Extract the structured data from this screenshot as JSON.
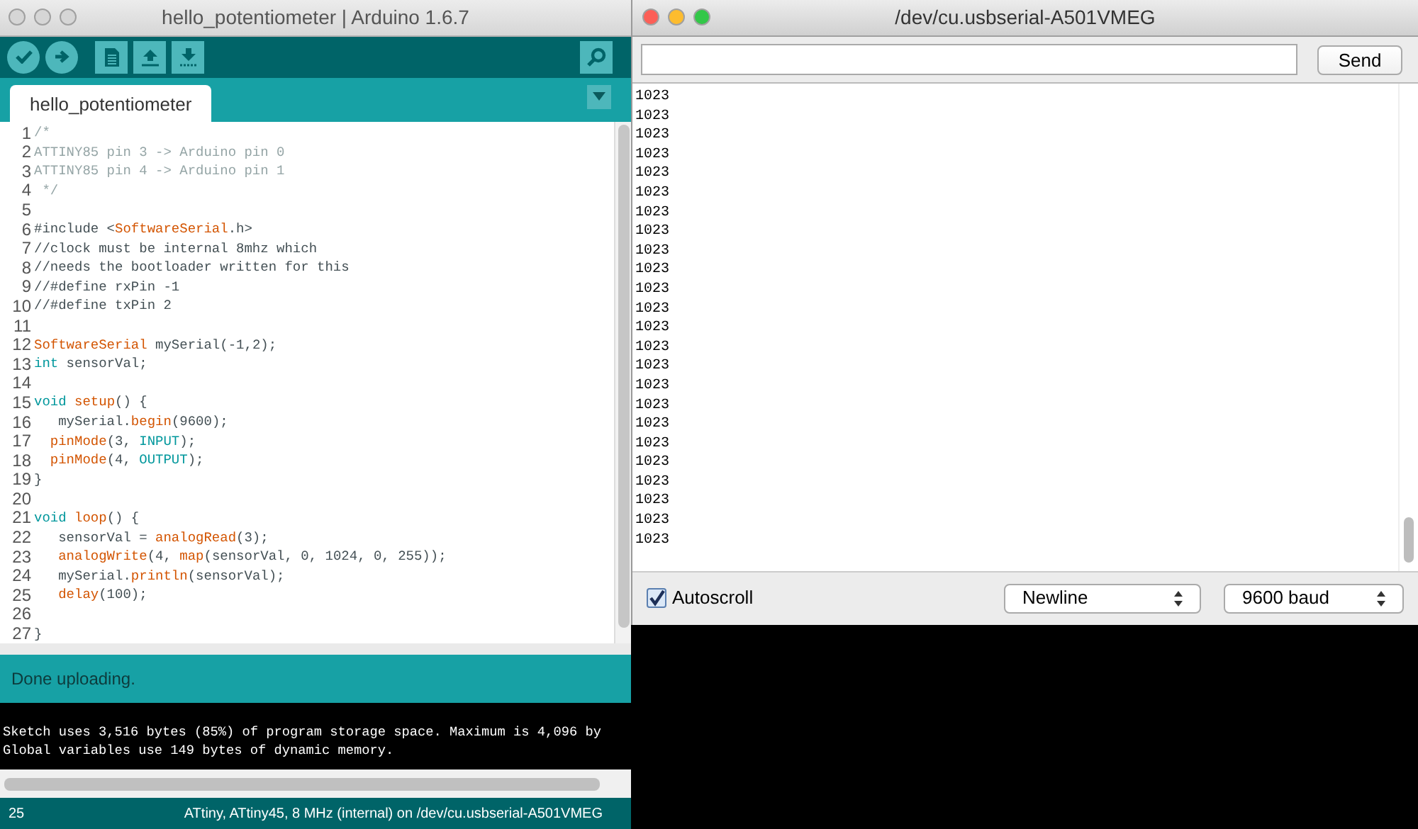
{
  "ide_window": {
    "title": "hello_potentiometer | Arduino 1.6.7",
    "tabs": [
      {
        "label": "hello_potentiometer",
        "selected": true
      }
    ],
    "code_lines": [
      {
        "number": "1",
        "segments": [
          {
            "kind": "comment",
            "text": "/*"
          }
        ]
      },
      {
        "number": "2",
        "segments": [
          {
            "kind": "comment",
            "text": "ATTINY85 pin 3 -> Arduino pin 0"
          }
        ]
      },
      {
        "number": "3",
        "segments": [
          {
            "kind": "comment",
            "text": "ATTINY85 pin 4 -> Arduino pin 1"
          }
        ]
      },
      {
        "number": "4",
        "segments": [
          {
            "kind": "comment",
            "text": " */"
          }
        ]
      },
      {
        "number": "5"
      },
      {
        "number": "6",
        "segments": [
          {
            "kind": "plain",
            "text": "#include <"
          },
          {
            "kind": "function",
            "text": "SoftwareSerial"
          },
          {
            "kind": "plain",
            "text": ".h>"
          }
        ]
      },
      {
        "number": "7",
        "segments": [
          {
            "kind": "plain",
            "text": "//clock must be internal 8mhz which"
          }
        ]
      },
      {
        "number": "8",
        "segments": [
          {
            "kind": "plain",
            "text": "//needs the bootloader written for this"
          }
        ]
      },
      {
        "number": "9",
        "segments": [
          {
            "kind": "plain",
            "text": "//#define rxPin -1"
          }
        ]
      },
      {
        "number": "10",
        "segments": [
          {
            "kind": "plain",
            "text": "//#define txPin 2"
          }
        ]
      },
      {
        "number": "11"
      },
      {
        "number": "12",
        "segments": [
          {
            "kind": "function",
            "text": "SoftwareSerial"
          },
          {
            "kind": "plain",
            "text": " mySerial(-1,2);"
          }
        ]
      },
      {
        "number": "13",
        "segments": [
          {
            "kind": "keyword",
            "text": "int"
          },
          {
            "kind": "plain",
            "text": " sensorVal;"
          }
        ]
      },
      {
        "number": "14"
      },
      {
        "number": "15",
        "segments": [
          {
            "kind": "keyword",
            "text": "void"
          },
          {
            "kind": "function",
            "text": " setup"
          },
          {
            "kind": "plain",
            "text": "() {"
          }
        ]
      },
      {
        "number": "16",
        "segments": [
          {
            "kind": "plain",
            "text": "   mySerial."
          },
          {
            "kind": "function",
            "text": "begin"
          },
          {
            "kind": "plain",
            "text": "(9600);"
          }
        ]
      },
      {
        "number": "17",
        "segments": [
          {
            "kind": "function",
            "text": "  pinMode"
          },
          {
            "kind": "plain",
            "text": "(3, "
          },
          {
            "kind": "keyword",
            "text": "INPUT"
          },
          {
            "kind": "plain",
            "text": ");"
          }
        ]
      },
      {
        "number": "18",
        "segments": [
          {
            "kind": "function",
            "text": "  pinMode"
          },
          {
            "kind": "plain",
            "text": "(4, "
          },
          {
            "kind": "keyword",
            "text": "OUTPUT"
          },
          {
            "kind": "plain",
            "text": ");"
          }
        ]
      },
      {
        "number": "19",
        "segments": [
          {
            "kind": "plain",
            "text": "}"
          }
        ]
      },
      {
        "number": "20"
      },
      {
        "number": "21",
        "segments": [
          {
            "kind": "keyword",
            "text": "void"
          },
          {
            "kind": "function",
            "text": " loop"
          },
          {
            "kind": "plain",
            "text": "() {"
          }
        ]
      },
      {
        "number": "22",
        "segments": [
          {
            "kind": "plain",
            "text": "   sensorVal = "
          },
          {
            "kind": "function",
            "text": "analogRead"
          },
          {
            "kind": "plain",
            "text": "(3);"
          }
        ]
      },
      {
        "number": "23",
        "segments": [
          {
            "kind": "function",
            "text": "   analogWrite"
          },
          {
            "kind": "plain",
            "text": "(4, "
          },
          {
            "kind": "function",
            "text": "map"
          },
          {
            "kind": "plain",
            "text": "(sensorVal, 0, 1024, 0, 255));"
          }
        ]
      },
      {
        "number": "24",
        "segments": [
          {
            "kind": "plain",
            "text": "   mySerial."
          },
          {
            "kind": "function",
            "text": "println"
          },
          {
            "kind": "plain",
            "text": "(sensorVal);"
          }
        ]
      },
      {
        "number": "25",
        "segments": [
          {
            "kind": "function",
            "text": "   delay"
          },
          {
            "kind": "plain",
            "text": "(100);"
          }
        ]
      },
      {
        "number": "26"
      },
      {
        "number": "27",
        "segments": [
          {
            "kind": "plain",
            "text": "}"
          }
        ]
      }
    ],
    "status_message": "Done uploading.",
    "console_lines": [
      "Sketch uses 3,516 bytes (85%) of program storage space. Maximum is 4,096 by",
      "Global variables use 149 bytes of dynamic memory."
    ],
    "status_bar": {
      "line": "25",
      "board": "ATtiny, ATtiny45, 8 MHz (internal) on /dev/cu.usbserial-A501VMEG"
    }
  },
  "serial_window": {
    "title": "/dev/cu.usbserial-A501VMEG",
    "send_button": "Send",
    "output_lines": [
      "1023",
      "1023",
      "1023",
      "1023",
      "1023",
      "1023",
      "1023",
      "1023",
      "1023",
      "1023",
      "1023",
      "1023",
      "1023",
      "1023",
      "1023",
      "1023",
      "1023",
      "1023",
      "1023",
      "1023",
      "1023",
      "1023",
      "1023",
      "1023"
    ],
    "autoscroll": {
      "label": "Autoscroll",
      "checked": true
    },
    "line_ending": "Newline",
    "baud_rate": "9600 baud"
  }
}
